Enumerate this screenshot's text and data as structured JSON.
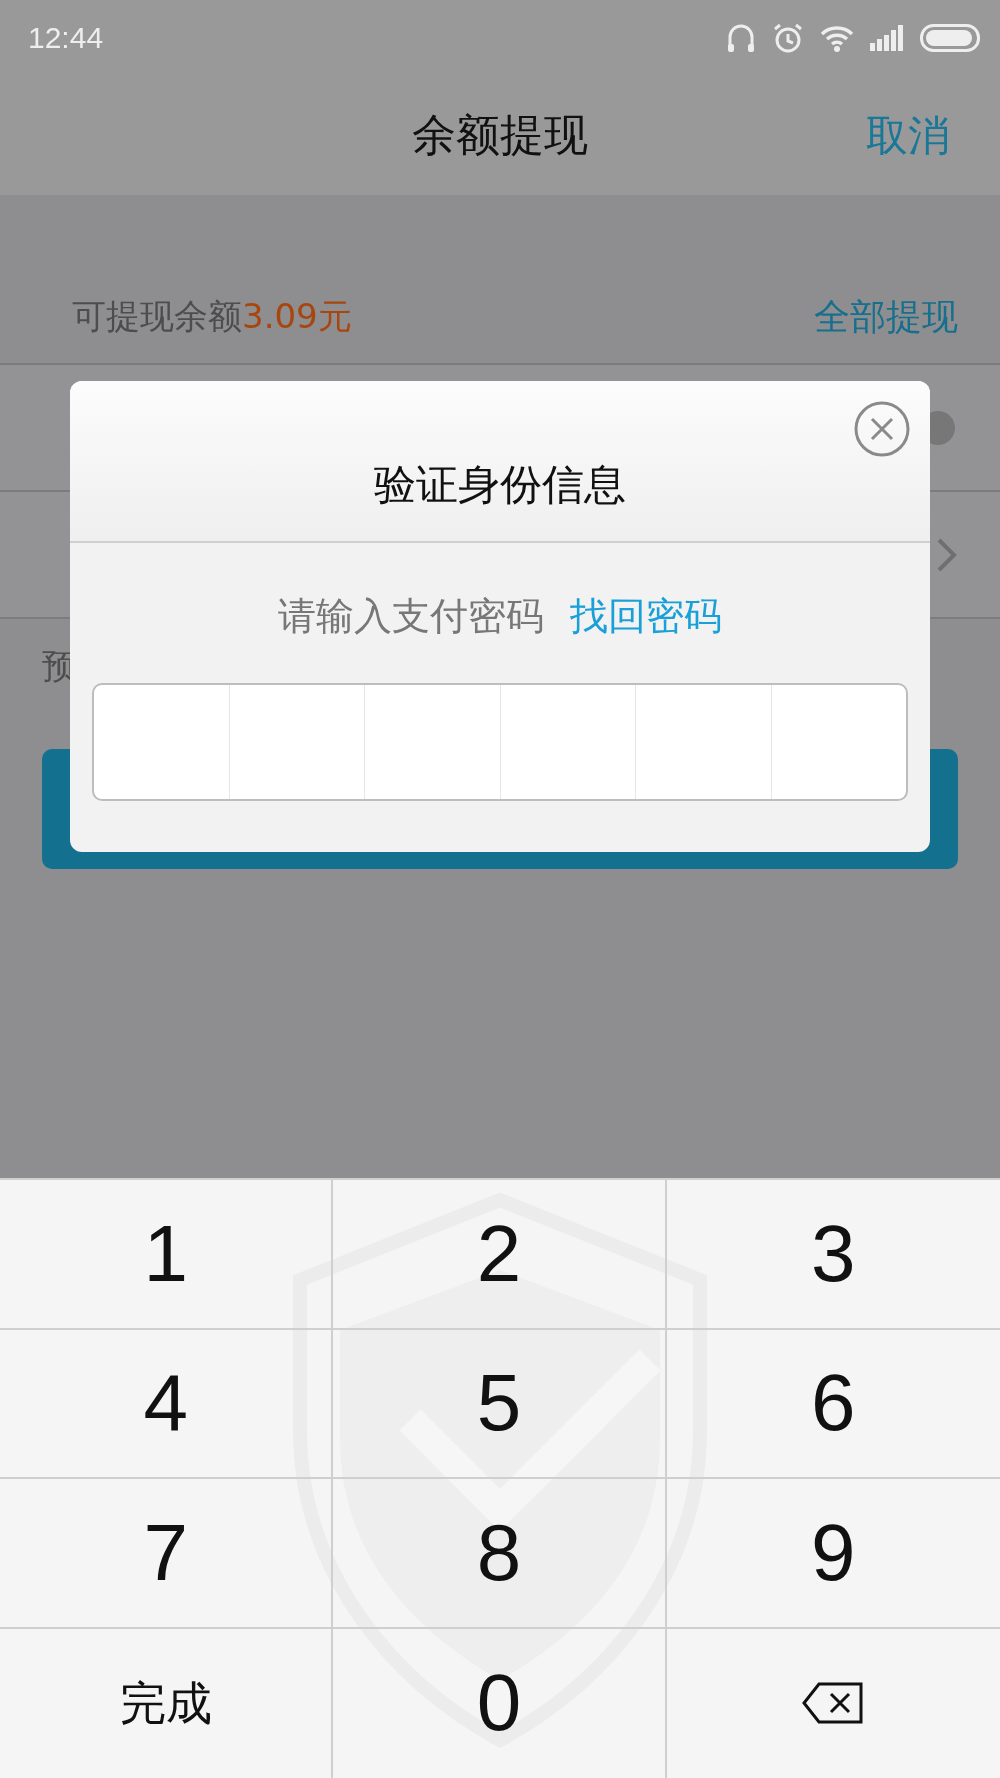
{
  "status_bar": {
    "time": "12:44"
  },
  "header": {
    "title": "余额提现",
    "cancel": "取消"
  },
  "balance": {
    "label": "可提现余额",
    "amount": "3.09元",
    "action": "全部提现"
  },
  "form_rows": [
    {
      "kind": "clear"
    },
    {
      "kind": "chevron"
    }
  ],
  "note": "预",
  "dialog": {
    "title": "验证身份信息",
    "prompt": "请输入支付密码",
    "link": "找回密码",
    "cells": [
      {
        "filled": false
      },
      {
        "filled": false
      },
      {
        "filled": false
      },
      {
        "filled": false
      },
      {
        "filled": false
      },
      {
        "filled": false
      }
    ]
  },
  "keypad": [
    {
      "kind": "digit",
      "label": "1"
    },
    {
      "kind": "digit",
      "label": "2"
    },
    {
      "kind": "digit",
      "label": "3"
    },
    {
      "kind": "digit",
      "label": "4"
    },
    {
      "kind": "digit",
      "label": "5"
    },
    {
      "kind": "digit",
      "label": "6"
    },
    {
      "kind": "digit",
      "label": "7"
    },
    {
      "kind": "digit",
      "label": "8"
    },
    {
      "kind": "digit",
      "label": "9"
    },
    {
      "kind": "done",
      "label": "完成"
    },
    {
      "kind": "digit",
      "label": "0"
    },
    {
      "kind": "backspace"
    }
  ]
}
